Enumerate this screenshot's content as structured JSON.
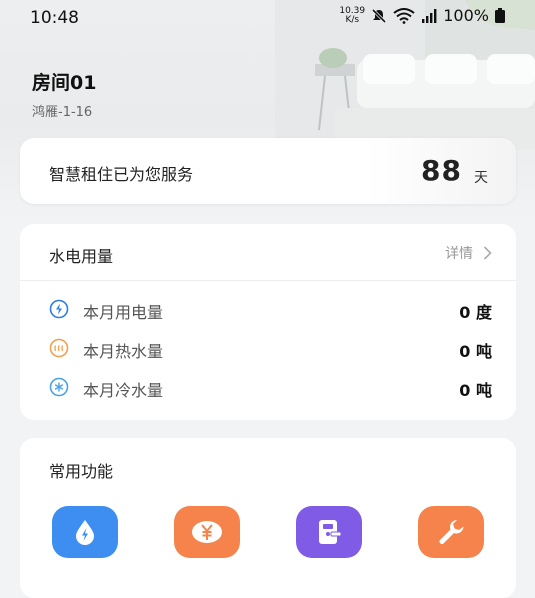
{
  "status_bar": {
    "time": "10:48",
    "net_speed_value": "10.39",
    "net_speed_unit": "K/s",
    "battery": "100%"
  },
  "room": {
    "title": "房间01",
    "subtitle": "鸿雁-1-16"
  },
  "service": {
    "text": "智慧租住已为您服务",
    "days": "88",
    "unit": "天"
  },
  "utilities": {
    "title": "水电用量",
    "detail_label": "详情",
    "rows": [
      {
        "label": "本月用电量",
        "value": "0 度",
        "icon": "electricity-icon",
        "color": "#2f7de1"
      },
      {
        "label": "本月热水量",
        "value": "0 吨",
        "icon": "hot-water-icon",
        "color": "#f0a050"
      },
      {
        "label": "本月冷水量",
        "value": "0 吨",
        "icon": "cold-water-icon",
        "color": "#4aa3e8"
      }
    ]
  },
  "functions": {
    "title": "常用功能",
    "items": [
      {
        "icon": "water-drop-icon",
        "color": "#3d8ef0"
      },
      {
        "icon": "yuan-icon",
        "color": "#f6834b"
      },
      {
        "icon": "door-lock-icon",
        "color": "#7f5be6"
      },
      {
        "icon": "wrench-icon",
        "color": "#f6834b"
      }
    ]
  }
}
